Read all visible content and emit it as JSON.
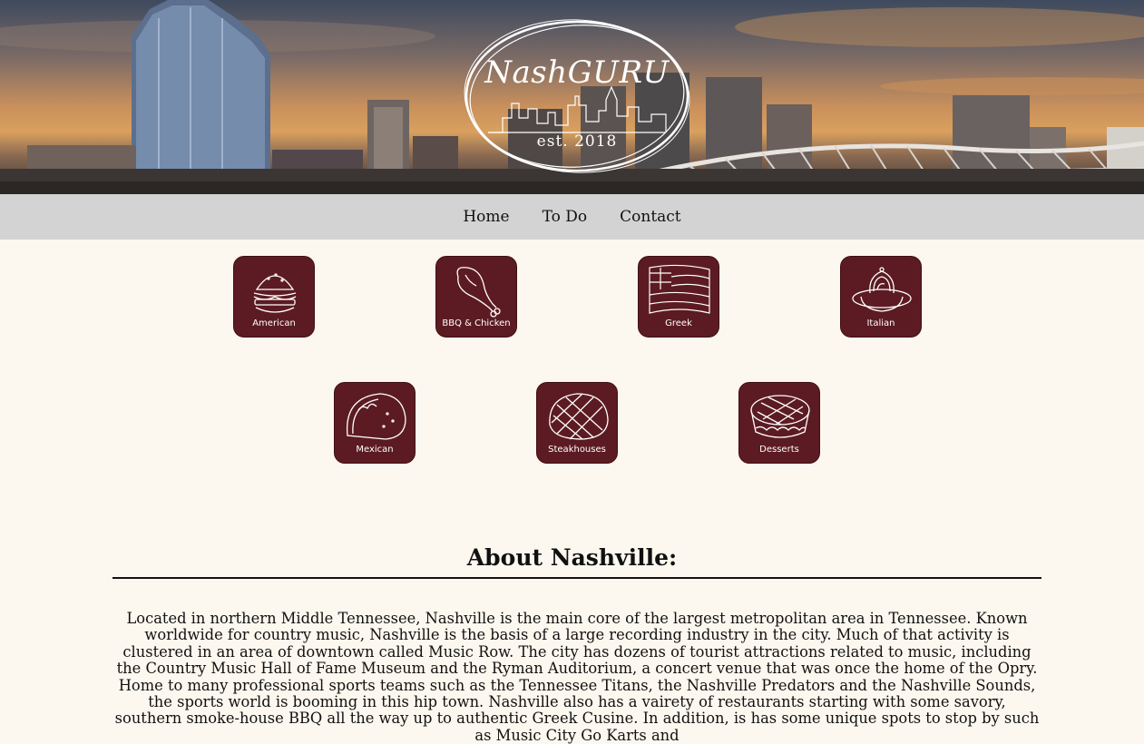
{
  "logo": {
    "title": "NashGURU",
    "established": "est. 2018"
  },
  "nav": {
    "items": [
      {
        "label": "Home"
      },
      {
        "label": "To Do"
      },
      {
        "label": "Contact"
      }
    ]
  },
  "categories": [
    {
      "label": "American",
      "icon": "burger-icon"
    },
    {
      "label": "BBQ & Chicken",
      "icon": "drumstick-icon"
    },
    {
      "label": "Greek",
      "icon": "greek-flag-icon"
    },
    {
      "label": "Italian",
      "icon": "pasta-icon"
    },
    {
      "label": "Mexican",
      "icon": "taco-icon"
    },
    {
      "label": "Steakhouses",
      "icon": "steak-icon"
    },
    {
      "label": "Desserts",
      "icon": "pie-icon"
    }
  ],
  "about": {
    "title": "About Nashville:",
    "text": "Located in northern Middle Tennessee, Nashville is the main core of the largest metropolitan area in Tennessee. Known worldwide for country music, Nashville is the basis of a large recording industry in the city. Much of that activity is clustered in an area of downtown called Music Row. The city has dozens of tourist attractions related to music, including the Country Music Hall of Fame Museum and the Ryman Auditorium, a concert venue that was once the home of the Opry. Home to many professional sports teams such as the Tennessee Titans, the Nashville Predators and the Nashville Sounds, the sports world is booming in this hip town. Nashville also has a vairety of restaurants starting with some savory, southern smoke-house BBQ all the way up to authentic Greek Cusine. In addition, is has some unique spots to stop by such as Music City Go Karts and"
  },
  "colors": {
    "tile_background": "#5c1b22",
    "nav_background": "#d3d3d3",
    "page_background": "#fdf8ef"
  }
}
